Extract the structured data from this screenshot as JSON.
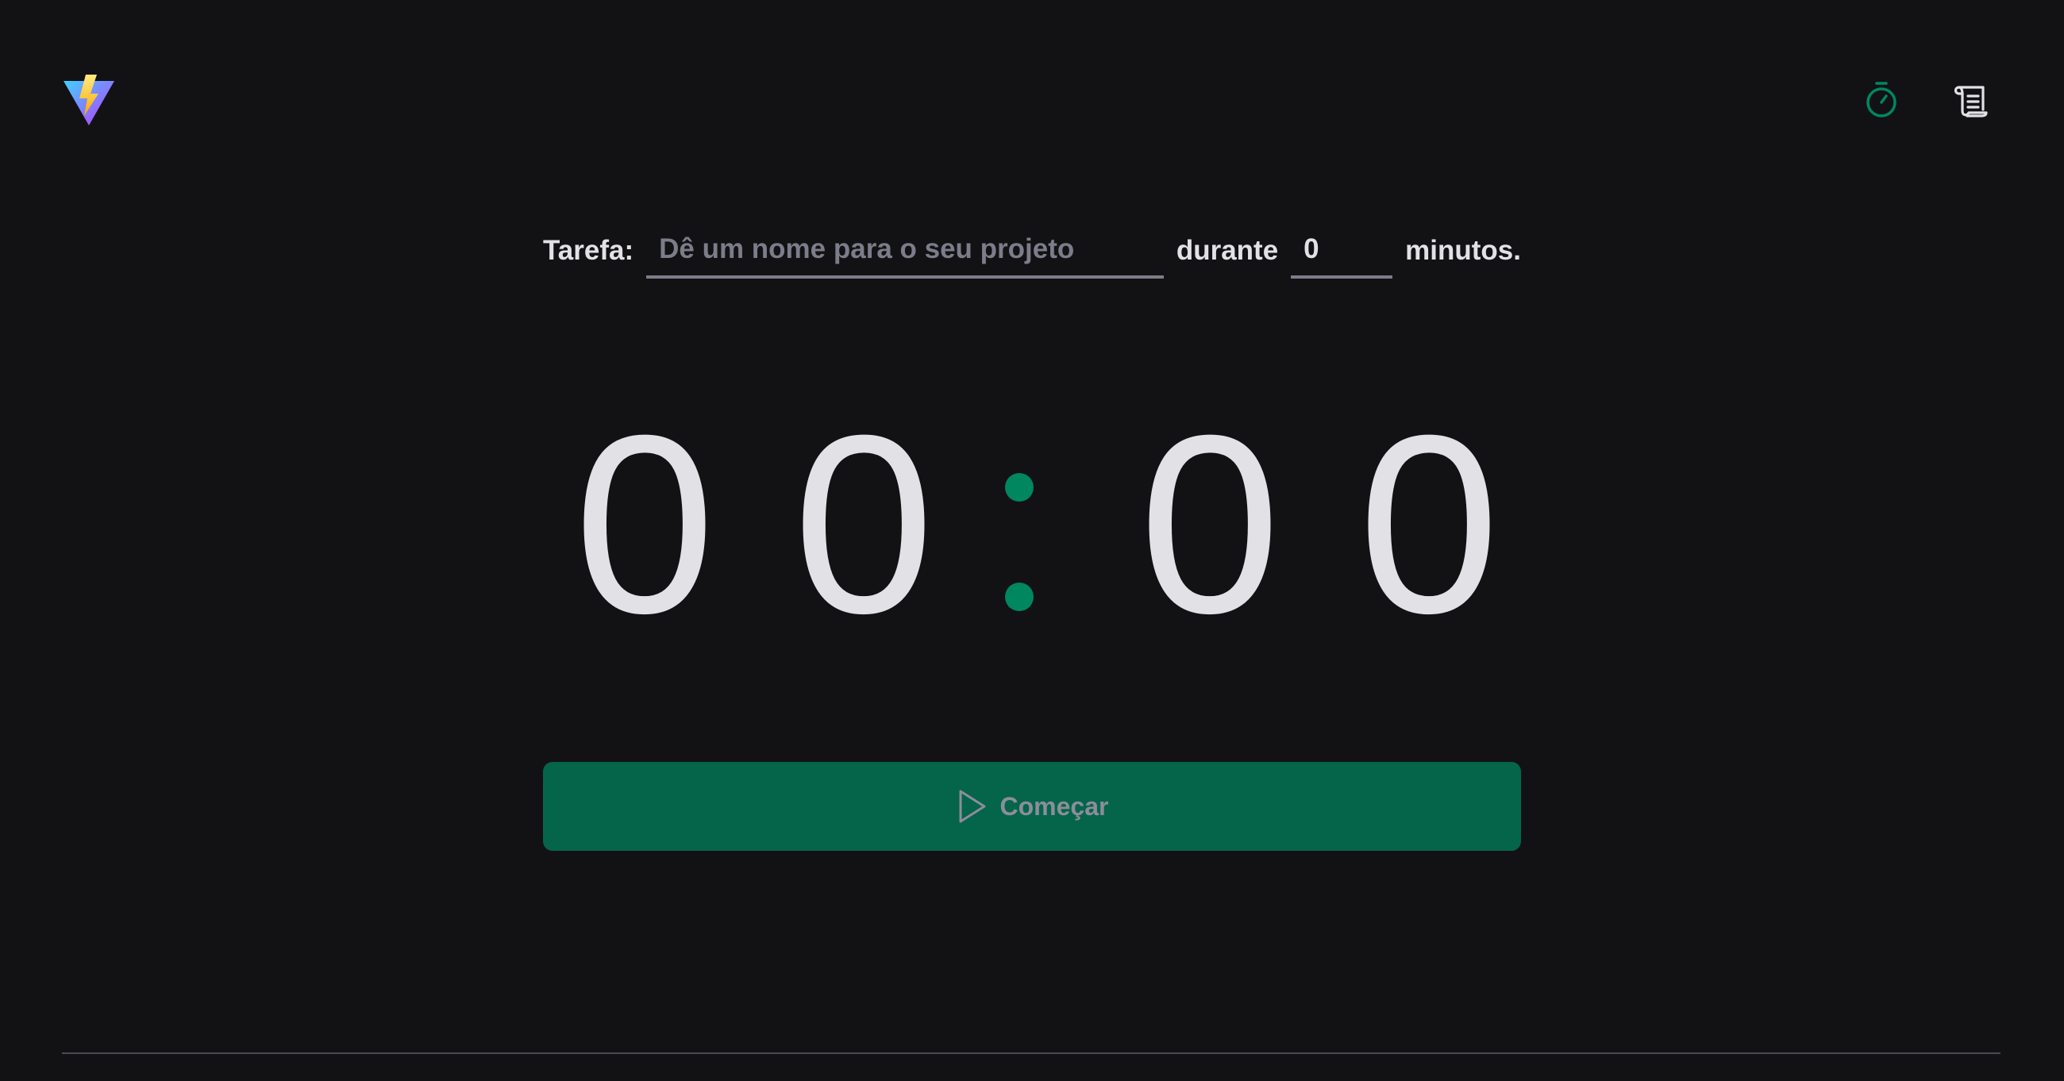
{
  "header": {
    "logo_icon": "vite-logo-icon",
    "nav": [
      {
        "icon": "timer-icon",
        "active": true,
        "color": "#00875f"
      },
      {
        "icon": "scroll-icon",
        "active": false,
        "color": "#e1e1e6"
      }
    ]
  },
  "form": {
    "task_label": "Tarefa:",
    "task_placeholder": "Dê um nome para o seu projeto",
    "task_value": "",
    "durante_label": "durante",
    "minutes_value": "0",
    "minutos_label": "minutos."
  },
  "countdown": {
    "minutes_1": "0",
    "minutes_2": "0",
    "separator": ":",
    "seconds_1": "0",
    "seconds_2": "0"
  },
  "start_button": {
    "label": "Começar",
    "icon": "play-icon"
  },
  "colors": {
    "background": "#121214",
    "accent": "#00875f",
    "button_bg": "#04654a",
    "text": "#e1e1e6",
    "muted": "#7c7c8a"
  }
}
